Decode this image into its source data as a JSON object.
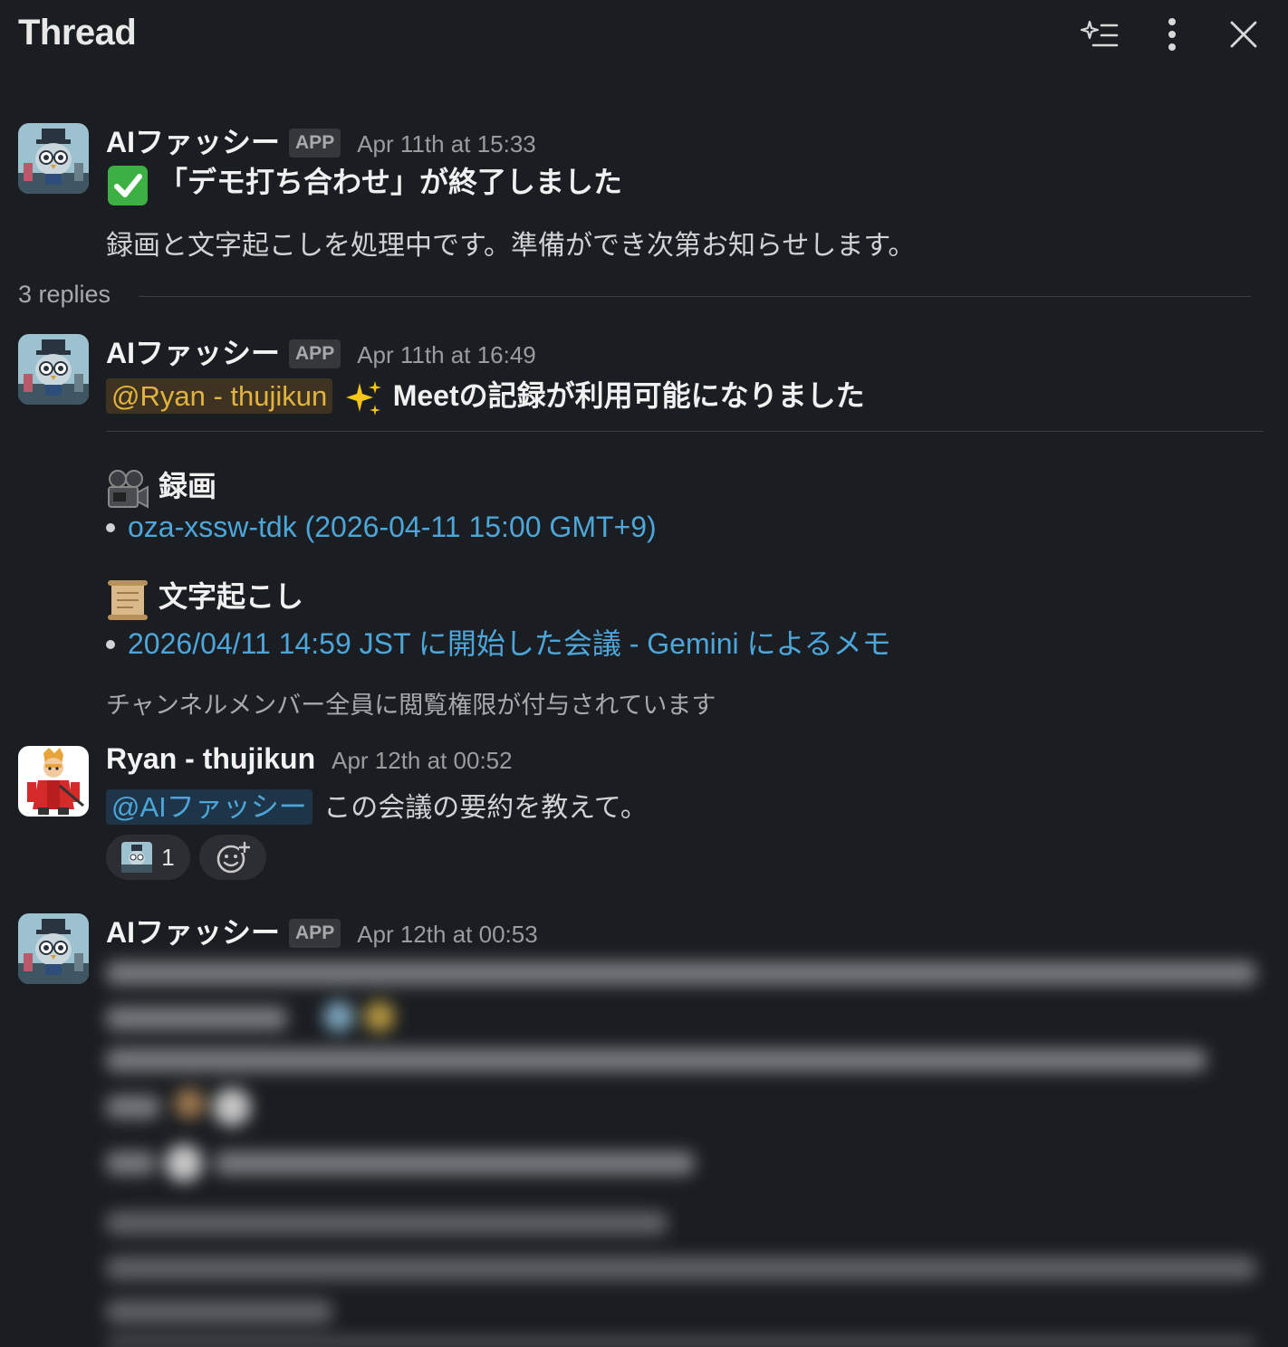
{
  "header": {
    "title": "Thread",
    "icons": [
      "sparkle-list-icon",
      "more-vertical-icon",
      "close-icon"
    ]
  },
  "messages": [
    {
      "sender": "AIファッシー",
      "badge": "APP",
      "time": "Apr 11th at 15:33",
      "title": "「デモ打ち合わせ」が終了しました",
      "body": "録画と文字起こしを処理中です。準備ができ次第お知らせします。"
    },
    {
      "sender": "AIファッシー",
      "badge": "APP",
      "time": "Apr 11th at 16:49",
      "mention": "@Ryan - thujikun",
      "title": "Meetの記録が利用可能になりました",
      "recording_heading": "録画",
      "recording_link": "oza-xssw-tdk (2026-04-11 15:00 GMT+9)",
      "transcript_heading": "文字起こし",
      "transcript_link": "2026/04/11 14:59 JST に開始した会議 - Gemini によるメモ",
      "note": "チャンネルメンバー全員に閲覧権限が付与されています"
    },
    {
      "sender": "Ryan - thujikun",
      "time": "Apr 12th at 00:52",
      "mention": "@AIファッシー",
      "body": "この会議の要約を教えて。",
      "reaction_count": "1"
    },
    {
      "sender": "AIファッシー",
      "badge": "APP",
      "time": "Apr 12th at 00:53"
    }
  ],
  "replies_label": "3 replies",
  "colors": {
    "background": "#1a1d21",
    "link": "#4da6d9",
    "mention_user": "#e3b341",
    "mention_app": "#4da6d9"
  }
}
